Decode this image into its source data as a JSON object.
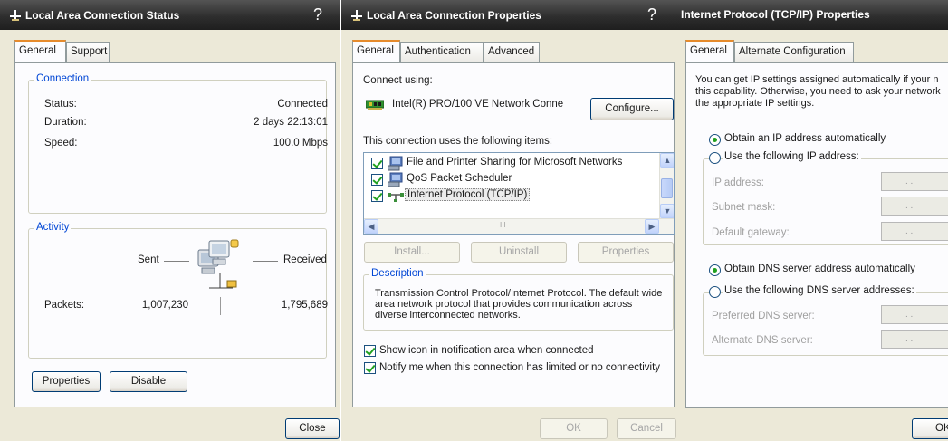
{
  "colors": {
    "title_bar": "#2e2e2e",
    "dialog_bg": "#ece9d8",
    "group_label": "#0046d5",
    "tab_highlight": "#e68b2c",
    "check": "#21a121"
  },
  "status_window": {
    "title": "Local Area Connection Status",
    "help_label": "?",
    "tabs": [
      {
        "label": "General"
      },
      {
        "label": "Support"
      }
    ],
    "connection_group": "Connection",
    "status_label": "Status:",
    "status_value": "Connected",
    "duration_label": "Duration:",
    "duration_value": "2 days 22:13:01",
    "speed_label": "Speed:",
    "speed_value": "100.0 Mbps",
    "activity_group": "Activity",
    "sent_label": "Sent",
    "received_label": "Received",
    "packets_label": "Packets:",
    "packets_sent": "1,007,230",
    "packets_received": "1,795,689",
    "properties_button": "Properties",
    "disable_button": "Disable",
    "close_button": "Close",
    "network_icon": "network-computers-icon"
  },
  "properties_window": {
    "title": "Local Area Connection Properties",
    "help_label": "?",
    "tabs": [
      {
        "label": "General"
      },
      {
        "label": "Authentication"
      },
      {
        "label": "Advanced"
      }
    ],
    "connect_using_label": "Connect using:",
    "adapter_name": "Intel(R) PRO/100 VE Network Conne",
    "configure_button": "Configure...",
    "items_label": "This connection uses the following items:",
    "items": [
      {
        "label": "File and Printer Sharing for Microsoft Networks",
        "icon": "network-service-icon"
      },
      {
        "label": "QoS Packet Scheduler",
        "icon": "network-service-icon"
      },
      {
        "label": "Internet Protocol (TCP/IP)",
        "icon": "protocol-icon"
      }
    ],
    "scroll_mid": "III",
    "install_button": "Install...",
    "uninstall_button": "Uninstall",
    "properties_button": "Properties",
    "description_group": "Description",
    "description_text": "Transmission Control Protocol/Internet Protocol. The default wide area network protocol that provides communication across diverse interconnected networks.",
    "show_icon_label": "Show icon in notification area when connected",
    "notify_label": "Notify me when this connection has limited or no connectivity",
    "ok_button": "OK",
    "cancel_button": "Cancel"
  },
  "tcpip_window": {
    "title": "Internet Protocol (TCP/IP) Properties",
    "tabs": [
      {
        "label": "General"
      },
      {
        "label": "Alternate Configuration"
      }
    ],
    "intro_line1": "You can get IP settings assigned automatically if your n",
    "intro_line2": "this capability. Otherwise, you need to ask your network",
    "intro_line3": "the appropriate IP settings.",
    "obtain_ip_label": "Obtain an IP address automatically",
    "use_ip_label": "Use the following IP address:",
    "ip_address_label": "IP address:",
    "subnet_label": "Subnet mask:",
    "gateway_label": "Default gateway:",
    "obtain_dns_label": "Obtain DNS server address automatically",
    "use_dns_label": "Use the following DNS server addresses:",
    "preferred_dns_label": "Preferred DNS server:",
    "alternate_dns_label": "Alternate DNS server:",
    "ip_dots": ". .",
    "ok_button": "OK"
  }
}
